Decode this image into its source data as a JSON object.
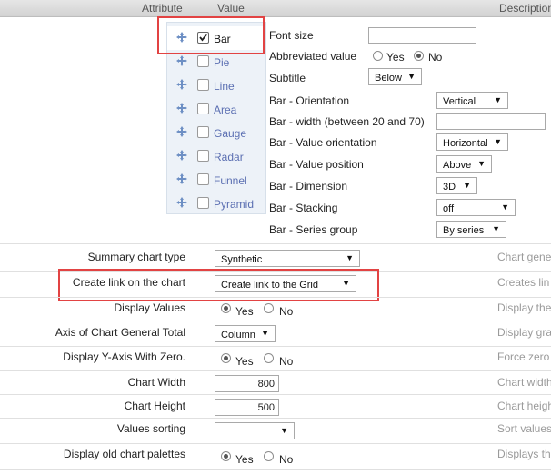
{
  "header": {
    "attribute": "Attribute",
    "value": "Value",
    "description": "Description"
  },
  "chart_types": [
    {
      "label": "Bar",
      "checked": true
    },
    {
      "label": "Pie",
      "checked": false
    },
    {
      "label": "Line",
      "checked": false
    },
    {
      "label": "Area",
      "checked": false
    },
    {
      "label": "Gauge",
      "checked": false
    },
    {
      "label": "Radar",
      "checked": false
    },
    {
      "label": "Funnel",
      "checked": false
    },
    {
      "label": "Pyramid",
      "checked": false
    }
  ],
  "options": {
    "font_size": {
      "label": "Font size",
      "value": ""
    },
    "abbreviated": {
      "label": "Abbreviated value",
      "yes": "Yes",
      "no": "No",
      "selected": "No"
    },
    "subtitle": {
      "label": "Subtitle",
      "value": "Below"
    },
    "orientation": {
      "label": "Bar - Orientation",
      "value": "Vertical"
    },
    "width": {
      "label": "Bar - width (between 20 and 70)",
      "value": ""
    },
    "value_orientation": {
      "label": "Bar - Value orientation",
      "value": "Horizontal"
    },
    "value_position": {
      "label": "Bar - Value position",
      "value": "Above"
    },
    "dimension": {
      "label": "Bar - Dimension",
      "value": "3D"
    },
    "stacking": {
      "label": "Bar - Stacking",
      "value": "off"
    },
    "series_group": {
      "label": "Bar - Series group",
      "value": "By series"
    }
  },
  "rows": {
    "summary_type": {
      "label": "Summary chart type",
      "value": "Synthetic",
      "desc": "Chart gene"
    },
    "create_link": {
      "label": "Create link on the chart",
      "value": "Create link to the Grid",
      "desc": "Creates lin"
    },
    "display_values": {
      "label": "Display Values",
      "yes": "Yes",
      "no": "No",
      "desc": "Display the"
    },
    "axis_total": {
      "label": "Axis of Chart General Total",
      "value": "Column",
      "desc": "Display gra"
    },
    "y_axis_zero": {
      "label": "Display Y-Axis With Zero.",
      "yes": "Yes",
      "no": "No",
      "desc": "Force zero"
    },
    "chart_width": {
      "label": "Chart Width",
      "value": "800",
      "desc": "Chart width"
    },
    "chart_height": {
      "label": "Chart Height",
      "value": "500",
      "desc": "Chart heigh"
    },
    "values_sorting": {
      "label": "Values sorting",
      "value": "",
      "desc": "Sort values"
    },
    "old_palettes": {
      "label": "Display old chart palettes",
      "yes": "Yes",
      "no": "No",
      "desc": "Displays th"
    }
  },
  "icons": {
    "move": "move-arrows-icon",
    "checkbox_checked": "checkbox-checked-icon",
    "dropdown": "chevron-down-icon"
  }
}
